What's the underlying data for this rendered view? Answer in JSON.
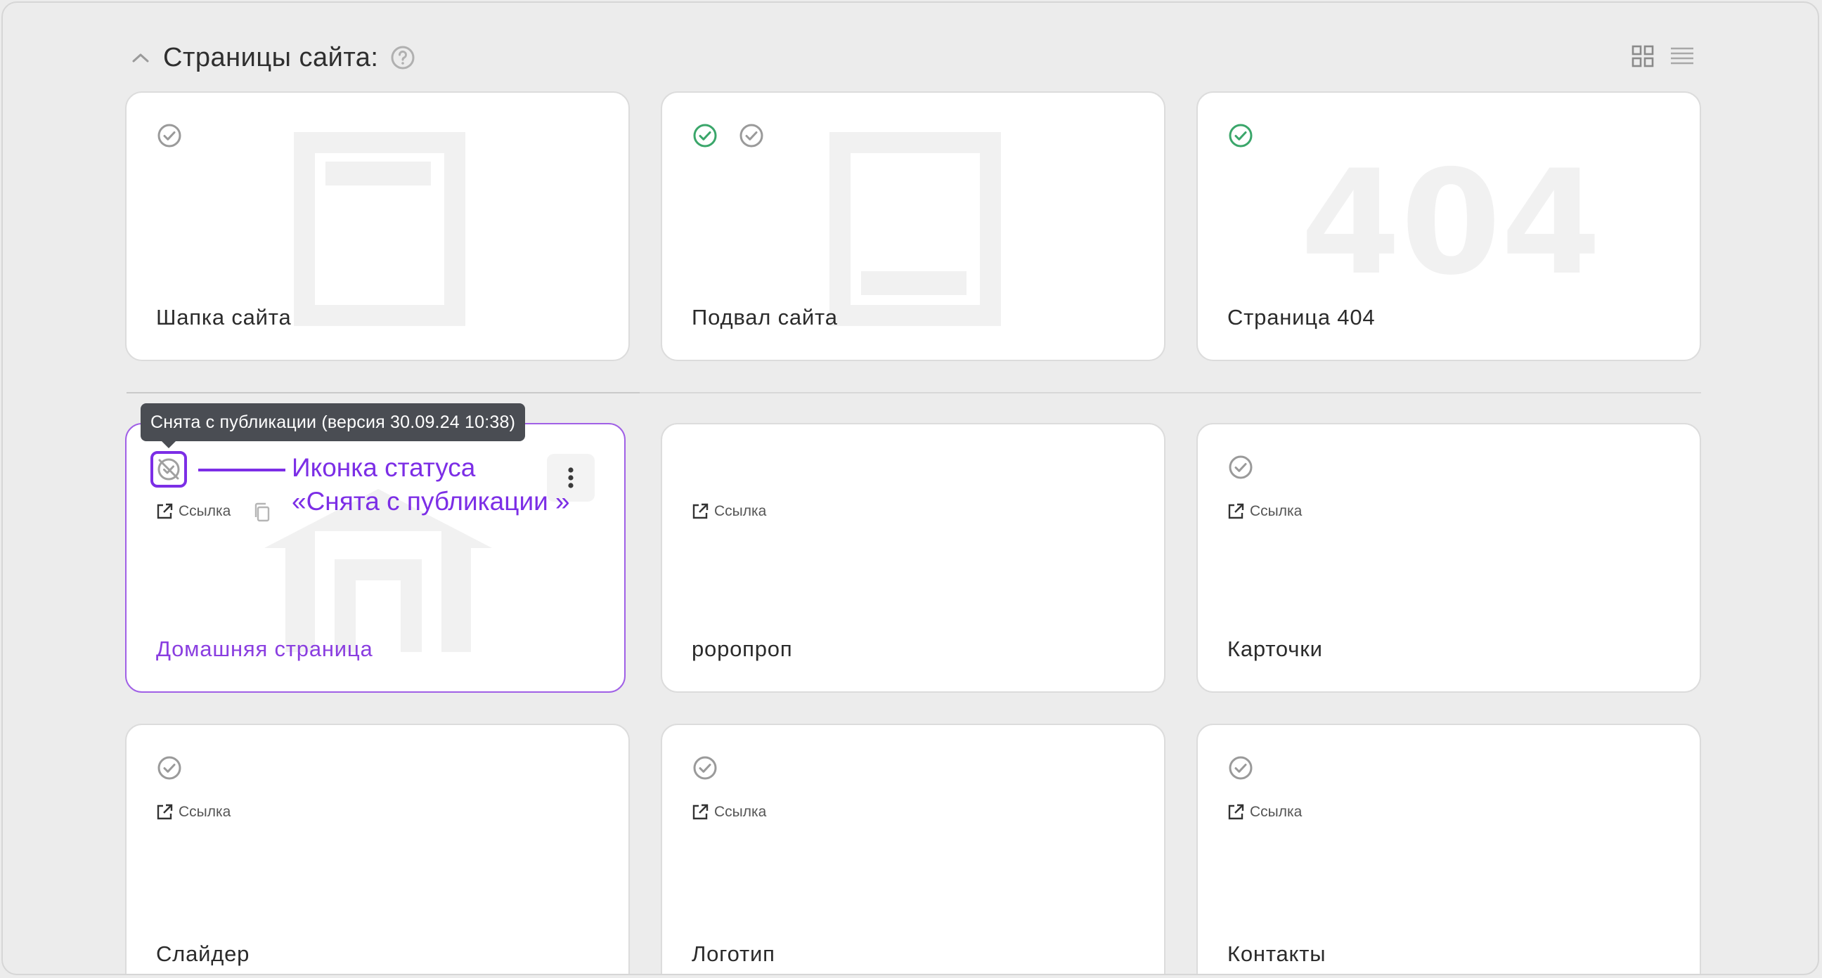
{
  "section": {
    "title": "Страницы сайта:",
    "collapse_icon": "chevron-up-icon",
    "help_icon": "question-circle-icon",
    "view_modes": [
      "grid-view-icon",
      "list-view-icon"
    ]
  },
  "system_pages": [
    {
      "name": "Шапка сайта",
      "statuses": [
        "published-gray"
      ],
      "illustration": "header-page"
    },
    {
      "name": "Подвал сайта",
      "statuses": [
        "published-green",
        "published-gray"
      ],
      "illustration": "footer-page"
    },
    {
      "name": "Страница 404",
      "statuses": [
        "published-green"
      ],
      "illustration": "404",
      "illustration_text": "404"
    }
  ],
  "pages": [
    {
      "name": "Домашняя страница",
      "status": "unpublished",
      "link_label": "Ссылка",
      "active": true
    },
    {
      "name": "роропроп",
      "status": "none",
      "link_label": "Ссылка"
    },
    {
      "name": "Карточки",
      "status": "published-gray",
      "link_label": "Ссылка"
    },
    {
      "name": "Слайдер",
      "status": "published-gray",
      "link_label": "Ссылка"
    },
    {
      "name": "Логотип",
      "status": "published-gray",
      "link_label": "Ссылка"
    },
    {
      "name": "Контакты",
      "status": "published-gray",
      "link_label": "Ссылка"
    }
  ],
  "tooltip": {
    "text": "Снята с публикации (версия 30.09.24 10:38)"
  },
  "annotation": {
    "line1": "Иконка статуса",
    "line2": "«Снята с публикации »"
  },
  "colors": {
    "accent": "#7c2ee6",
    "active_text": "#8a3ee0",
    "published": "#3aa66a",
    "status_gray": "#9a9a9a",
    "tooltip_bg": "#4a4d53"
  }
}
